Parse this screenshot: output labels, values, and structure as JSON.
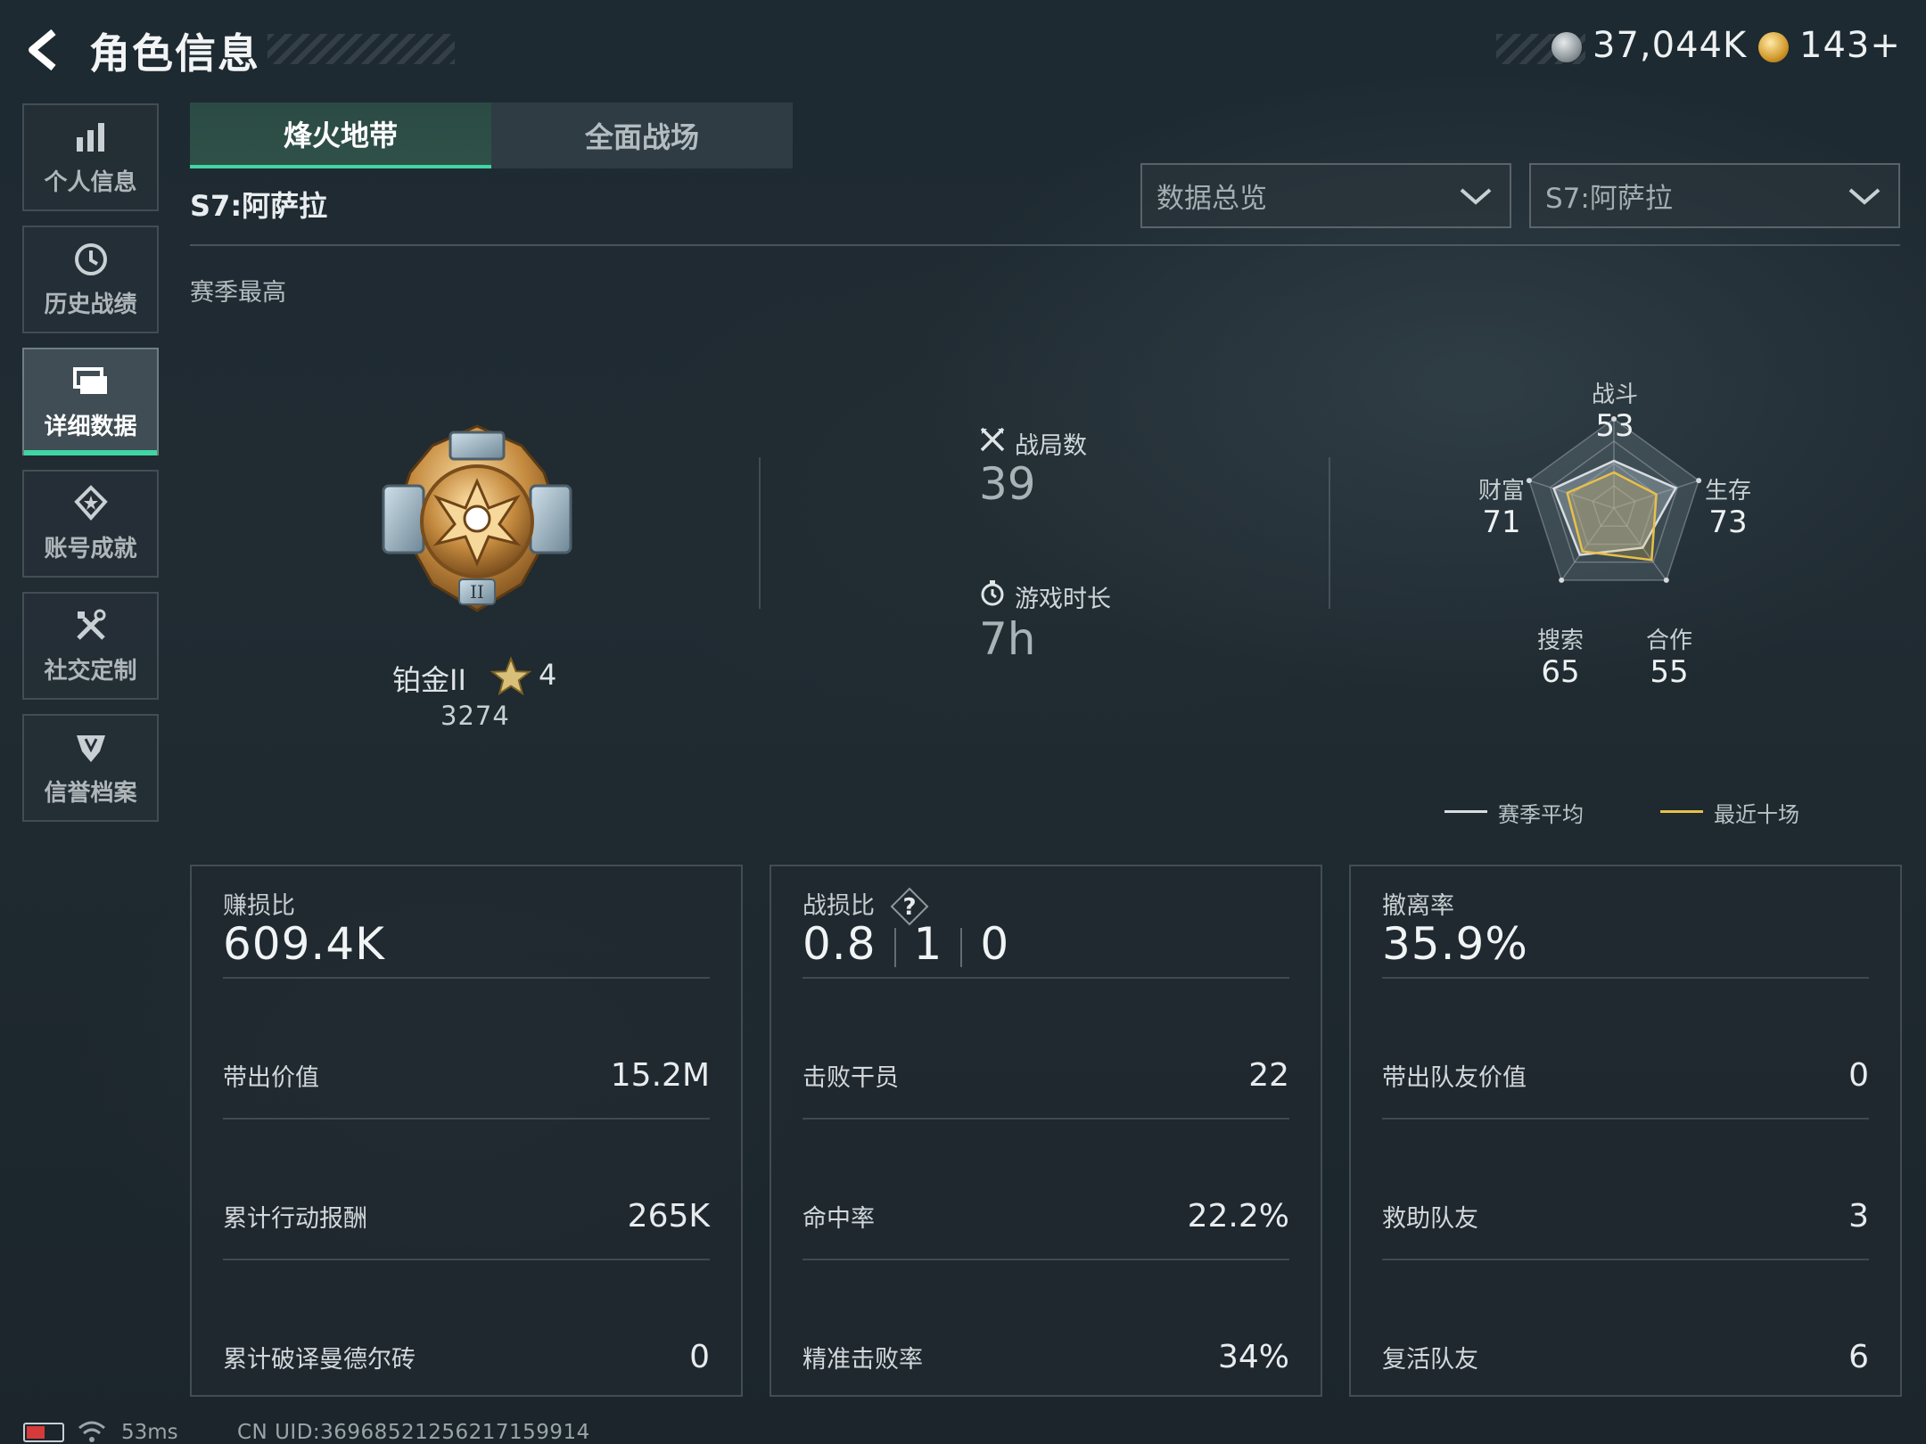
{
  "header": {
    "title": "角色信息",
    "currency_silver": "37,044K",
    "currency_gold": "143+"
  },
  "sidebar": {
    "items": [
      {
        "label": "个人信息",
        "icon": "bar-chart-icon"
      },
      {
        "label": "历史战绩",
        "icon": "history-icon"
      },
      {
        "label": "详细数据",
        "icon": "folder-icon",
        "active": true
      },
      {
        "label": "账号成就",
        "icon": "achievement-icon"
      },
      {
        "label": "社交定制",
        "icon": "tools-icon"
      },
      {
        "label": "信誉档案",
        "icon": "reputation-icon"
      }
    ]
  },
  "tabs": {
    "active": "烽火地带",
    "inactive": "全面战场"
  },
  "season_title": "S7:阿萨拉",
  "dropdowns": {
    "view": "数据总览",
    "season": "S7:阿萨拉"
  },
  "section_label": "赛季最高",
  "rank": {
    "name": "铂金II",
    "stars": "4",
    "points": "3274"
  },
  "stats": {
    "matches_label": "战局数",
    "matches_value": "39",
    "playtime_label": "游戏时长",
    "playtime_value": "7h"
  },
  "radar": {
    "axes": [
      {
        "label": "战斗",
        "value": "53"
      },
      {
        "label": "生存",
        "value": "73"
      },
      {
        "label": "合作",
        "value": "55"
      },
      {
        "label": "搜索",
        "value": "65"
      },
      {
        "label": "财富",
        "value": "71"
      }
    ],
    "season_avg": [
      53,
      73,
      55,
      65,
      71
    ],
    "recent_ten": [
      40,
      50,
      72,
      60,
      55
    ],
    "legend_season": "赛季平均",
    "legend_recent": "最近十场",
    "color_season": "#d8dde0",
    "color_recent": "#e8c04a"
  },
  "cards": {
    "card1": {
      "head_label": "赚损比",
      "head_value": "609.4K",
      "rows": [
        {
          "label": "带出价值",
          "value": "15.2M"
        },
        {
          "label": "累计行动报酬",
          "value": "265K"
        },
        {
          "label": "累计破译曼德尔砖",
          "value": "0"
        }
      ]
    },
    "card2": {
      "head_label": "战损比",
      "head_values": [
        "0.8",
        "1",
        "0"
      ],
      "rows": [
        {
          "label": "击败干员",
          "value": "22"
        },
        {
          "label": "命中率",
          "value": "22.2%"
        },
        {
          "label": "精准击败率",
          "value": "34%"
        }
      ]
    },
    "card3": {
      "head_label": "撤离率",
      "head_value": "35.9%",
      "rows": [
        {
          "label": "带出队友价值",
          "value": "0"
        },
        {
          "label": "救助队友",
          "value": "3"
        },
        {
          "label": "复活队友",
          "value": "6"
        }
      ]
    }
  },
  "status": {
    "ping": "53ms",
    "uid": "CN UID:3696852125621715991​4",
    "accent": "#3fd5a4"
  }
}
